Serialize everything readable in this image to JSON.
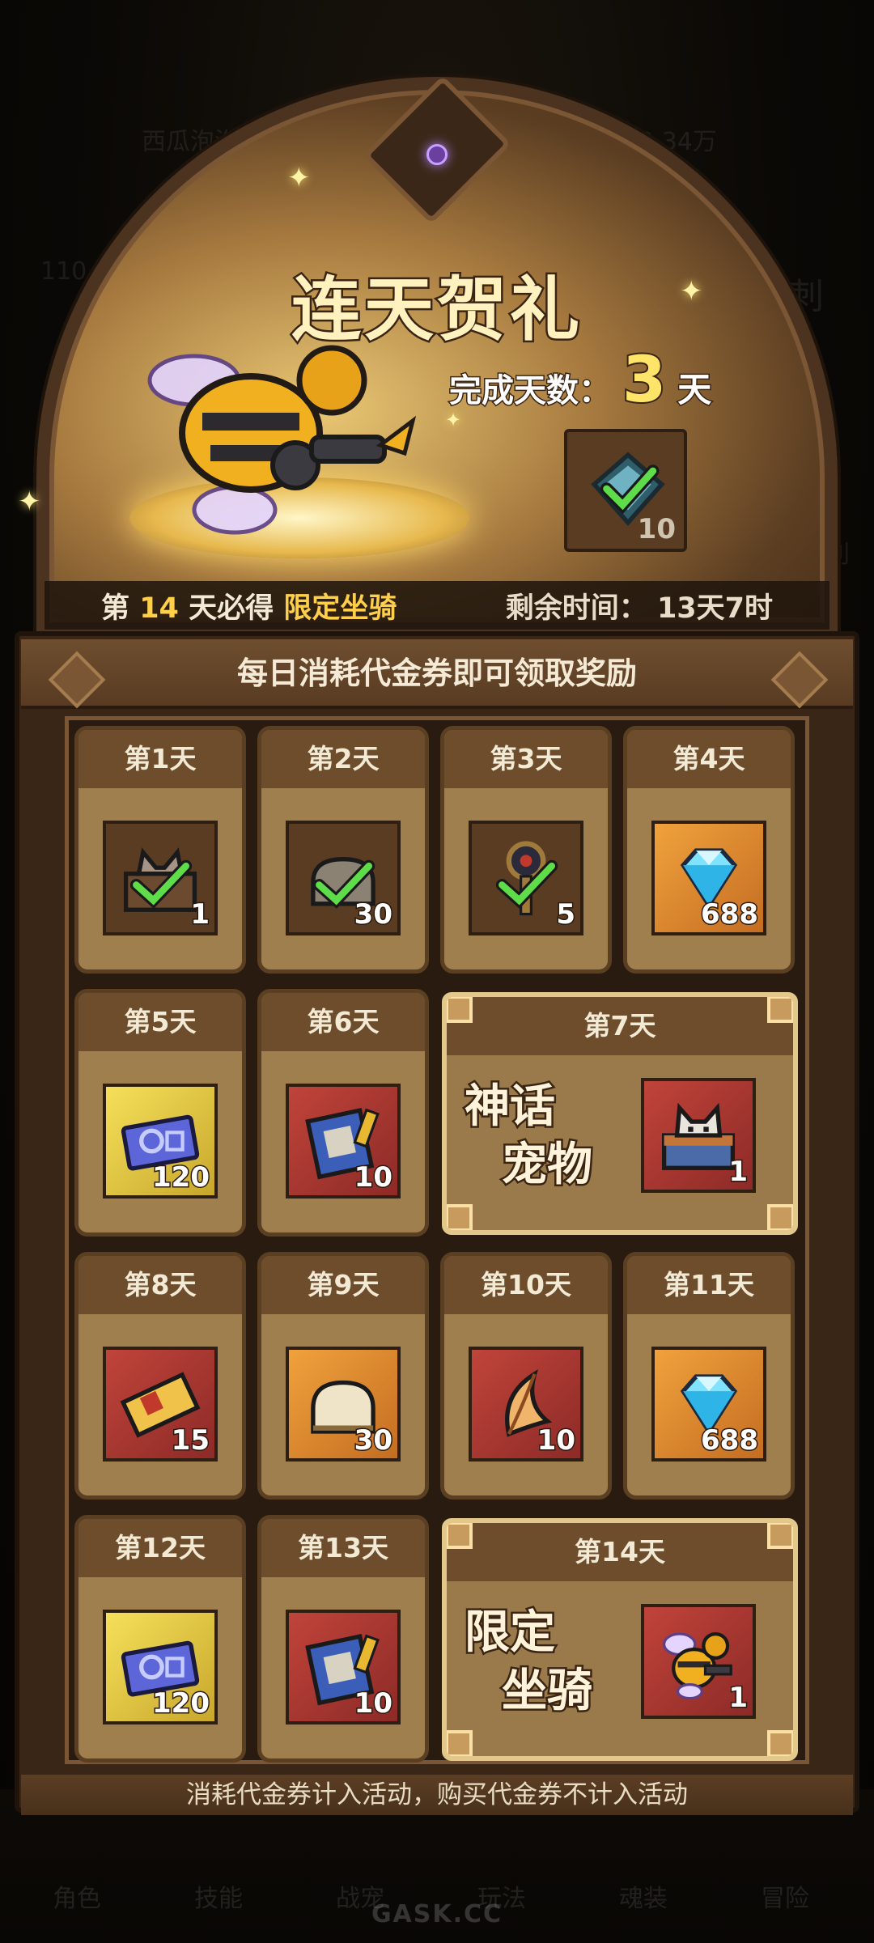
{
  "background_ui": {
    "ghost_texts": [
      "西瓜泡泡",
      "19.34万",
      "110",
      "冲刺",
      "利"
    ],
    "nav": [
      "角色",
      "技能",
      "战宠",
      "玩法",
      "魂装",
      "冒险"
    ],
    "watermark": "GASK.CC"
  },
  "banner": {
    "title": "连天贺礼",
    "days_label": "完成天数：",
    "days_value": "3",
    "days_unit": "天",
    "hero_reward_count": "10",
    "strip": {
      "prefix": "第",
      "day": "14",
      "middle": "天必得",
      "reward_name": "限定坐骑",
      "remaining_label": "剩余时间：",
      "remaining_value": "13天7时"
    }
  },
  "panel": {
    "header": "每日消耗代金券即可领取奖励",
    "footer": "消耗代金券计入活动，购买代金券不计入活动",
    "days": [
      {
        "label": "第1天",
        "count": "1",
        "icon": "pet-box-claimed-icon",
        "bg": "brown"
      },
      {
        "label": "第2天",
        "count": "30",
        "icon": "bread-claimed-icon",
        "bg": "brown"
      },
      {
        "label": "第3天",
        "count": "5",
        "icon": "key-claimed-icon",
        "bg": "brown"
      },
      {
        "label": "第4天",
        "count": "688",
        "icon": "diamond-icon",
        "bg": "orange"
      },
      {
        "label": "第5天",
        "count": "120",
        "icon": "ticket-icon",
        "bg": "gold"
      },
      {
        "label": "第6天",
        "count": "10",
        "icon": "book-icon",
        "bg": "red"
      },
      {
        "label": "第7天",
        "count": "1",
        "icon": "pet-box-icon",
        "bg": "red",
        "big_label_1": "神话",
        "big_label_2": "宠物"
      },
      {
        "label": "第8天",
        "count": "15",
        "icon": "scroll-ticket-icon",
        "bg": "red"
      },
      {
        "label": "第9天",
        "count": "30",
        "icon": "bread-icon",
        "bg": "orange"
      },
      {
        "label": "第10天",
        "count": "10",
        "icon": "feather-icon",
        "bg": "red"
      },
      {
        "label": "第11天",
        "count": "688",
        "icon": "diamond-icon",
        "bg": "orange"
      },
      {
        "label": "第12天",
        "count": "120",
        "icon": "ticket-icon",
        "bg": "gold"
      },
      {
        "label": "第13天",
        "count": "10",
        "icon": "book-icon",
        "bg": "red"
      },
      {
        "label": "第14天",
        "count": "1",
        "icon": "bee-mount-icon",
        "bg": "red",
        "big_label_1": "限定",
        "big_label_2": "坐骑"
      }
    ]
  }
}
